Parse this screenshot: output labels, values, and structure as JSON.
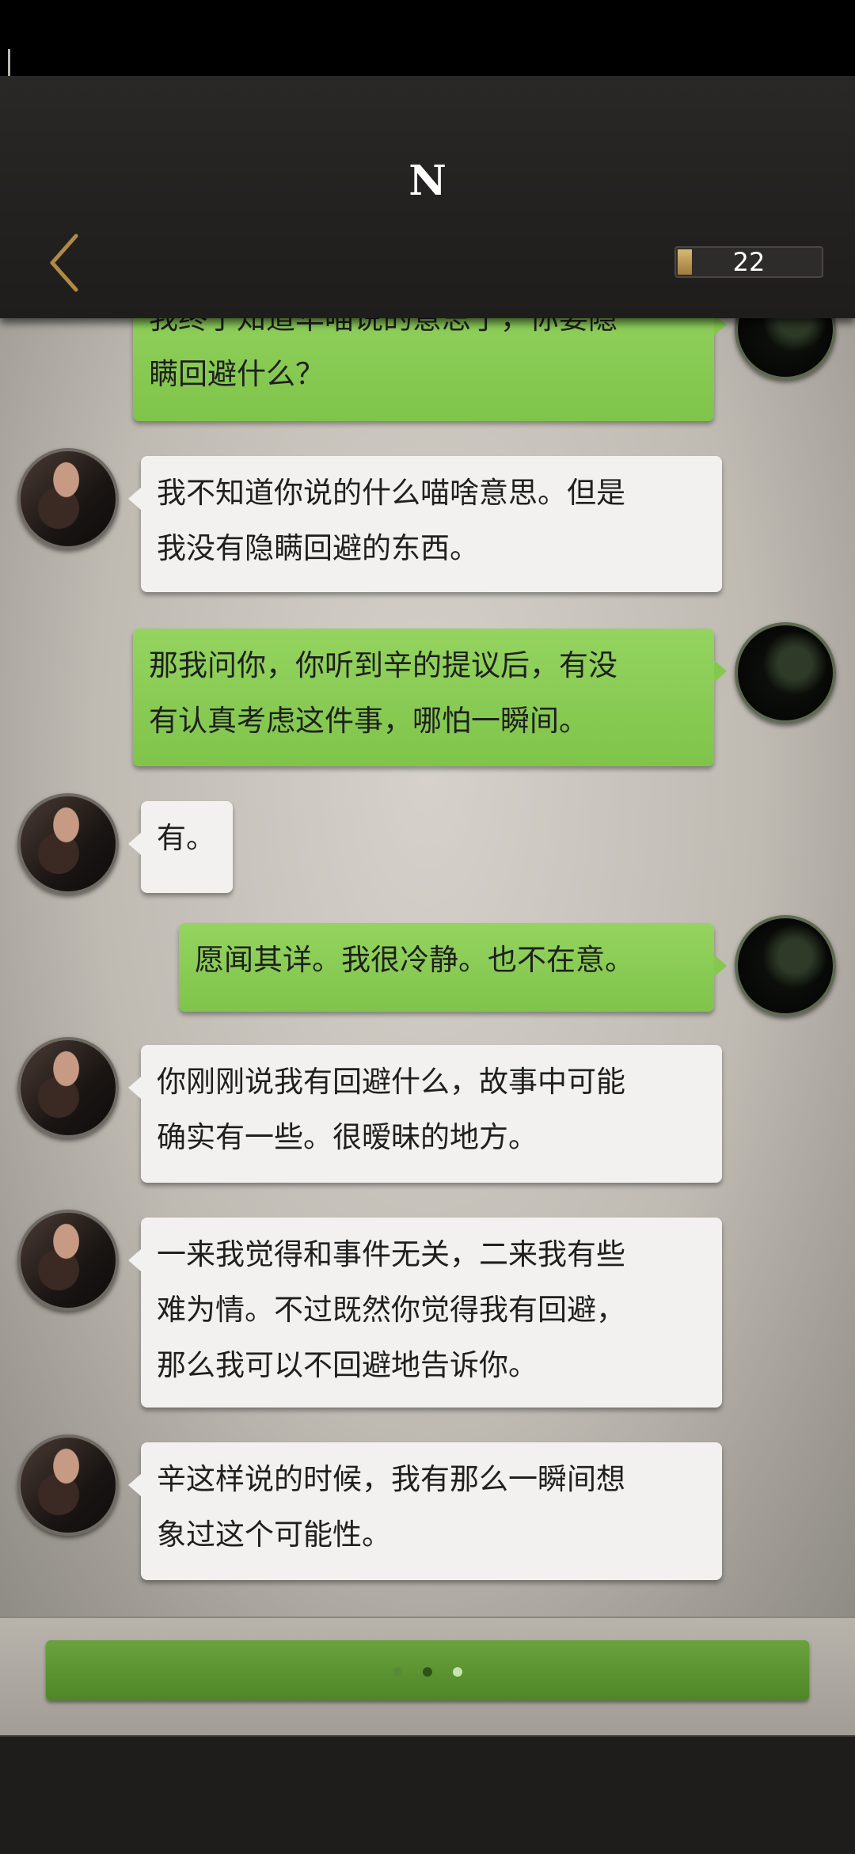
{
  "header": {
    "title": "N",
    "counter": "22"
  },
  "messages": [
    {
      "side": "right",
      "text": "我终于知道华喵说的意思了，你要隐瞒回避什么？"
    },
    {
      "side": "left",
      "line1": "我不知道你说的什么喵啥意思。但是",
      "line2": "我没有隐瞒回避的东西。"
    },
    {
      "side": "right",
      "line1": "那我问你，你听到辛的提议后，有没",
      "line2": "有认真考虑这件事，哪怕一瞬间。"
    },
    {
      "side": "left",
      "line1": "有。"
    },
    {
      "side": "right",
      "line1": "愿闻其详。我很冷静。也不在意。"
    },
    {
      "side": "left",
      "line1": "你刚刚说我有回避什么，故事中可能",
      "line2": "确实有一些。很暧昧的地方。"
    },
    {
      "side": "left",
      "line1": "一来我觉得和事件无关，二来我有些",
      "line2": "难为情。不过既然你觉得我有回避，",
      "line3": "那么我可以不回避地告诉你。"
    },
    {
      "side": "left",
      "line1": "辛这样说的时候，我有那么一瞬间想",
      "line2": "象过这个可能性。"
    }
  ],
  "first_partial": {
    "line1": "我终于知道华喵说的意思了，你要隐",
    "line2": "瞒回避什么？"
  },
  "colors": {
    "bubble_green": "#8fd15a",
    "bubble_white": "#f2f1ef",
    "button_green": "#5d962f",
    "accent_gold": "#b08a45"
  },
  "icons": {
    "back": "chevron-left-icon",
    "counter": "energy-bar-icon"
  }
}
